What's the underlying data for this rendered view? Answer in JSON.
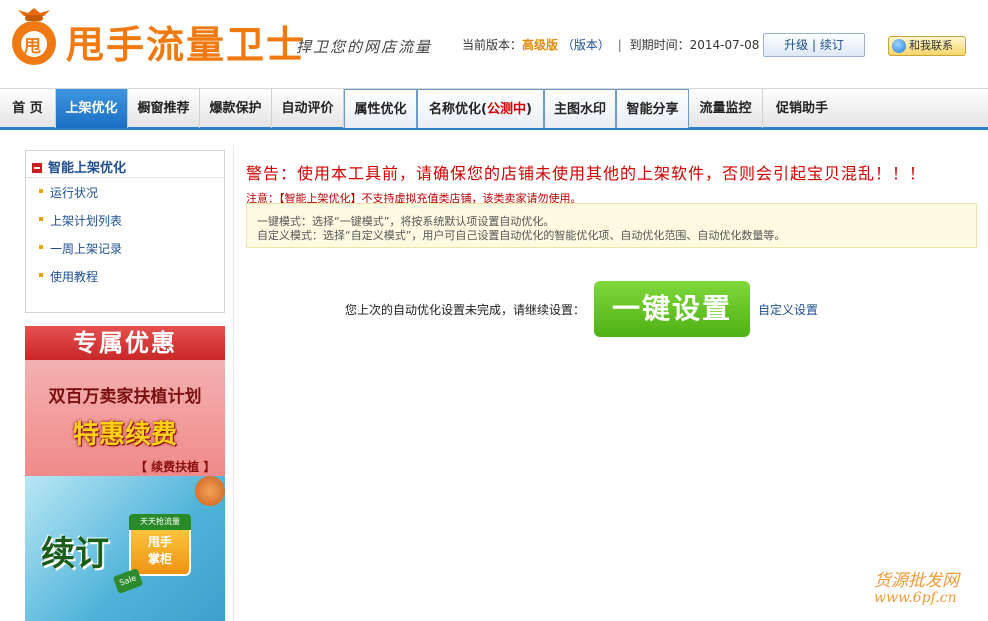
{
  "header": {
    "logo_char": "甩",
    "logo_title": "甩手流量卫士",
    "slogan": "捍卫您的网店流量",
    "version_prefix": "当前版本：",
    "version_name": "高级版",
    "version_link": "（版本）",
    "expire_label": "到期时间：",
    "expire_date": "2014-07-08",
    "upgrade_label": "升级 | 续订",
    "contact_label": "和我联系"
  },
  "nav": {
    "items": [
      {
        "label": "首 页"
      },
      {
        "label": "上架优化"
      },
      {
        "label": "橱窗推荐"
      },
      {
        "label": "爆款保护"
      },
      {
        "label": "自动评价"
      },
      {
        "label": "属性优化"
      },
      {
        "label": "名称优化"
      },
      {
        "label": "主图水印"
      },
      {
        "label": "智能分享"
      },
      {
        "label": "流量监控"
      },
      {
        "label": "促销助手"
      }
    ],
    "beta_open": "(",
    "beta_tag": "公测中",
    "beta_close": ")"
  },
  "sidebar": {
    "title": "智能上架优化",
    "items": [
      {
        "label": "运行状况"
      },
      {
        "label": "上架计划列表"
      },
      {
        "label": "一周上架记录"
      },
      {
        "label": "使用教程"
      }
    ]
  },
  "promo": {
    "headline": "专属优惠",
    "plan": "双百万卖家扶植计划",
    "renew": "特惠续费",
    "support": "【 续费扶植 】",
    "renew_big": "续订",
    "badge_top": "天天抢流量",
    "badge_line1": "甩手",
    "badge_line2": "掌柜",
    "sale": "Sale"
  },
  "main": {
    "warning": "警告：使用本工具前，请确保您的店铺未使用其他的上架软件，否则会引起宝贝混乱！！！",
    "note": "注意：【智能上架优化】不支持虚拟充值类店铺，该类卖家请勿使用。",
    "info_line1": "一键模式：选择“一键模式”，将按系统默认项设置自动优化。",
    "info_line2": "自定义模式：选择“自定义模式”，用户可自己设置自动优化的智能优化项、自动优化范围、自动优化数量等。",
    "prompt": "您上次的自动优化设置未完成，请继续设置：",
    "one_click_button": "一键设置",
    "custom_link": "自定义设置"
  },
  "watermark": {
    "line1": "货源批发网",
    "line2": "www.6pf.cn"
  }
}
